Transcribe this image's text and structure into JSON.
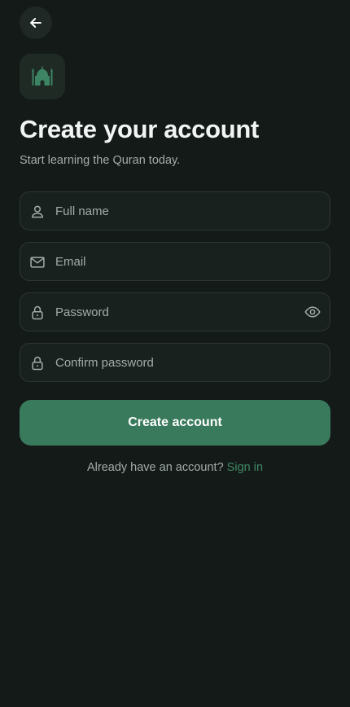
{
  "header": {
    "back_icon": "arrow-left-icon",
    "logo_icon": "mosque-icon"
  },
  "page": {
    "title": "Create your account",
    "subtitle": "Start learning the Quran today."
  },
  "form": {
    "full_name": {
      "placeholder": "Full name",
      "value": "",
      "icon": "user-icon"
    },
    "email": {
      "placeholder": "Email",
      "value": "",
      "icon": "mail-icon"
    },
    "password": {
      "placeholder": "Password",
      "value": "",
      "icon": "lock-icon",
      "toggle_icon": "eye-icon"
    },
    "confirm_password": {
      "placeholder": "Confirm password",
      "value": "",
      "icon": "lock-icon"
    },
    "submit_label": "Create account"
  },
  "footer": {
    "prompt": "Already have an account?",
    "link_label": "Sign in"
  },
  "colors": {
    "background": "#141a18",
    "field_background": "#19211e",
    "field_border": "#2b3631",
    "accent": "#3a7a5c",
    "link": "#3f8a66",
    "muted_text": "#a3aca8"
  }
}
